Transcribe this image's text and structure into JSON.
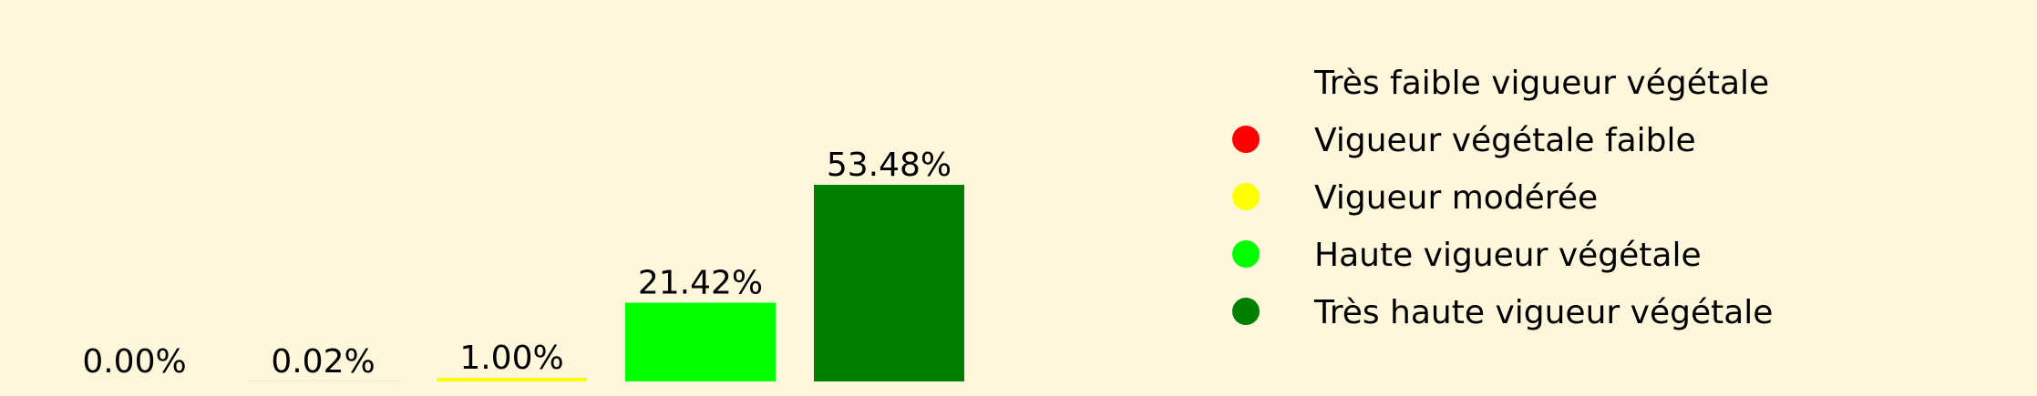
{
  "chart_data": {
    "type": "bar",
    "categories": [
      "Très faible vigueur végétale",
      "Vigueur végétale faible",
      "Vigueur modérée",
      "Haute vigueur végétale",
      "Très haute vigueur végétale"
    ],
    "values": [
      0.0,
      0.02,
      1.0,
      21.42,
      53.48
    ],
    "value_labels": [
      "0.00%",
      "0.02%",
      "1.00%",
      "21.42%",
      "53.48%"
    ],
    "colors": [
      "#8b0000",
      "#ff0000",
      "#ffff00",
      "#00ff00",
      "#008000"
    ],
    "ylim": [
      0,
      53.48
    ],
    "grid": false,
    "axes_visible": false,
    "legend": {
      "placement": "right",
      "entries": [
        {
          "label": "Très faible vigueur végétale",
          "color": "#8b0000",
          "marker_visible": false
        },
        {
          "label": "Vigueur végétale faible",
          "color": "#ff0000",
          "marker_visible": true
        },
        {
          "label": "Vigueur modérée",
          "color": "#ffff00",
          "marker_visible": true
        },
        {
          "label": "Haute vigueur végétale",
          "color": "#00ff00",
          "marker_visible": true
        },
        {
          "label": "Très haute vigueur végétale",
          "color": "#008000",
          "marker_visible": true
        }
      ]
    },
    "background": "#fef7dc"
  }
}
